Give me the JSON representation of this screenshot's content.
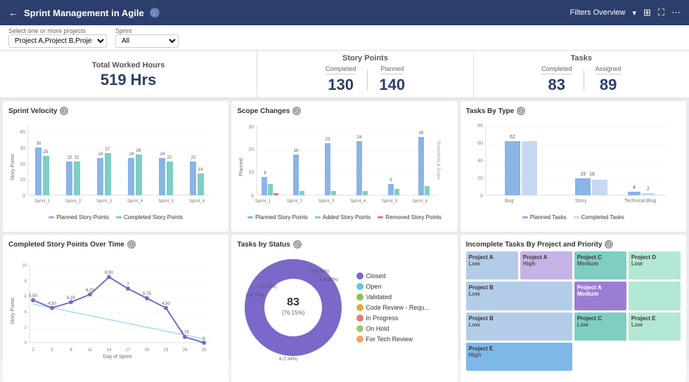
{
  "header": {
    "title": "Sprint Management in Agile",
    "back_icon": "←",
    "info_icon": "ⓘ",
    "filters_label": "Filters Overview",
    "icon_options": "⊞",
    "icon_expand": "⛶",
    "icon_more": "⋯"
  },
  "filters": {
    "project_label": "Select one or more projects",
    "project_value": "Project A,Project B,Project D,Project...",
    "sprint_label": "Sprint",
    "sprint_value": "All"
  },
  "kpi": {
    "hours_title": "Total Worked Hours",
    "hours_value": "519 Hrs",
    "points_title": "Story Points",
    "points_completed_label": "Completed",
    "points_completed_value": "130",
    "points_planned_label": "Planned",
    "points_planned_value": "140",
    "tasks_title": "Tasks",
    "tasks_completed_label": "Completed",
    "tasks_completed_value": "83",
    "tasks_assigned_label": "Assigned",
    "tasks_assigned_value": "89"
  },
  "charts": {
    "velocity_title": "Sprint Velocity",
    "scope_title": "Scope Changes",
    "tasks_by_type_title": "Tasks By Type",
    "completed_over_time_title": "Completed Story Points Over Time",
    "tasks_by_status_title": "Tasks by Status",
    "incomplete_tasks_title": "Incomplete Tasks By Project and Priority"
  },
  "velocity": {
    "sprints": [
      "Sprint_1",
      "Sprint_2",
      "Sprint_3",
      "Sprint_4",
      "Sprint_5",
      "Sprint_6"
    ],
    "planned": [
      30,
      22,
      24,
      24,
      24,
      22
    ],
    "completed": [
      25,
      22,
      27,
      26,
      22,
      14
    ],
    "y_axis": [
      0,
      10,
      20,
      30,
      40
    ],
    "y_label": "Story Points",
    "legend_planned": "Planned Story Points",
    "legend_completed": "Completed Story Points"
  },
  "scope": {
    "sprints": [
      "Sprint_1",
      "Sprint_2",
      "Sprint_3",
      "Sprint_4",
      "Sprint_5",
      "Sprint_6"
    ],
    "planned": [
      8,
      18,
      23,
      24,
      5,
      26
    ],
    "added": [
      5,
      2,
      2,
      2,
      3,
      4
    ],
    "removed": [
      1,
      0,
      0,
      0,
      0,
      0
    ],
    "y_axis": [
      0,
      10,
      20,
      30
    ],
    "legend_planned": "Planned Story Points",
    "legend_added": "Added Story Points",
    "legend_removed": "Removed Story Points"
  },
  "tasks_by_type": {
    "types": [
      "Bug",
      "Story",
      "Technical Blog"
    ],
    "planned": [
      62,
      19,
      4
    ],
    "completed": [
      62,
      18,
      2
    ],
    "y_axis": [
      0,
      20,
      40,
      60,
      80
    ]
  },
  "completed_over_time": {
    "days": [
      2,
      5,
      8,
      11,
      14,
      17,
      20,
      23,
      26,
      29
    ],
    "values": [
      5.5,
      4.5,
      5.25,
      6.25,
      8.5,
      7,
      5.75,
      4.5,
      0.75,
      0
    ],
    "y_axis": [
      0,
      2,
      4,
      6,
      8,
      10
    ],
    "y_label": "Story Points",
    "x_label": "Day of Sprint"
  },
  "tasks_by_status": {
    "segments": [
      {
        "label": "Closed",
        "value": 83,
        "pct": "76.15%",
        "color": "#7b68c8"
      },
      {
        "label": "Open",
        "value": 8,
        "pct": "7.34%",
        "color": "#5bc8e0"
      },
      {
        "label": "Validated",
        "value": 3,
        "pct": "2.75%",
        "color": "#8bc34a"
      },
      {
        "label": "Code Review - Requ...",
        "value": 3,
        "pct": "2.75%",
        "color": "#e8a838"
      },
      {
        "label": "In Progress",
        "value": 3,
        "pct": "2.75%",
        "color": "#e87878"
      },
      {
        "label": "On Hold",
        "value": 1,
        "pct": "0.92%",
        "color": "#a0c878"
      },
      {
        "label": "For Tech Review",
        "value": 1,
        "pct": "0.92%",
        "color": "#f4a460"
      }
    ],
    "center_label": "83",
    "center_sublabel": "(76.15%)"
  },
  "treemap": {
    "cells": [
      {
        "project": "Project A",
        "priority": "Low",
        "color": "#b3cde8",
        "span_col": 1,
        "span_row": 1
      },
      {
        "project": "Project A",
        "priority": "High",
        "color": "#c5b3e8",
        "span_col": 1,
        "span_row": 1
      },
      {
        "project": "Project C",
        "priority": "Medium",
        "color": "#7ecec4",
        "span_col": 1,
        "span_row": 1
      },
      {
        "project": "Project D",
        "priority": "Low",
        "color": "#b3e8d4",
        "span_col": 1,
        "span_row": 1
      },
      {
        "project": "Project B",
        "priority": "Low",
        "color": "#b3cde8",
        "span_col": 2,
        "span_row": 1
      },
      {
        "project": "Project A",
        "priority": "Medium",
        "color": "#9b7ed4",
        "span_col": 1,
        "span_row": 1
      },
      {
        "project": "",
        "priority": "",
        "color": "#b3e8d4",
        "span_col": 1,
        "span_row": 1
      },
      {
        "project": "Project C",
        "priority": "Low",
        "color": "#7ecec4",
        "span_col": 1,
        "span_row": 1
      },
      {
        "project": "Project E",
        "priority": "High",
        "color": "#7eb8e8",
        "span_col": 1,
        "span_row": 1
      },
      {
        "project": "Project E",
        "priority": "Low",
        "color": "#b3e8d4",
        "span_col": 1,
        "span_row": 1
      }
    ]
  }
}
